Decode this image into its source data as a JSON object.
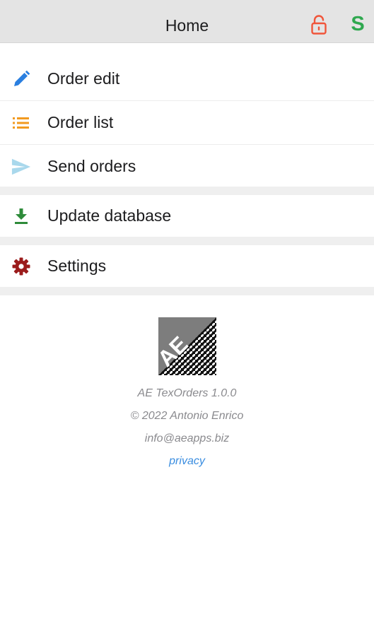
{
  "header": {
    "title": "Home",
    "lock_icon": "unlocked-padlock-icon",
    "lock_color": "#f0553a",
    "sync_label": "S",
    "sync_color": "#2fa84f"
  },
  "menu": {
    "group1": [
      {
        "label": "Order edit",
        "icon": "pencil-icon",
        "color": "#2a7fe0"
      },
      {
        "label": "Order list",
        "icon": "list-icon",
        "color": "#f29a1f"
      },
      {
        "label": "Send orders",
        "icon": "send-icon",
        "color": "#a9d8ec"
      }
    ],
    "group2": [
      {
        "label": "Update database",
        "icon": "download-icon",
        "color": "#2e8b3a"
      }
    ],
    "group3": [
      {
        "label": "Settings",
        "icon": "gear-icon",
        "color": "#9b1c1c"
      }
    ]
  },
  "footer": {
    "logo_text": "AE",
    "app_version": "AE TexOrders 1.0.0",
    "copyright": "© 2022 Antonio Enrico",
    "email": "info@aeapps.biz",
    "privacy_link": "privacy"
  }
}
